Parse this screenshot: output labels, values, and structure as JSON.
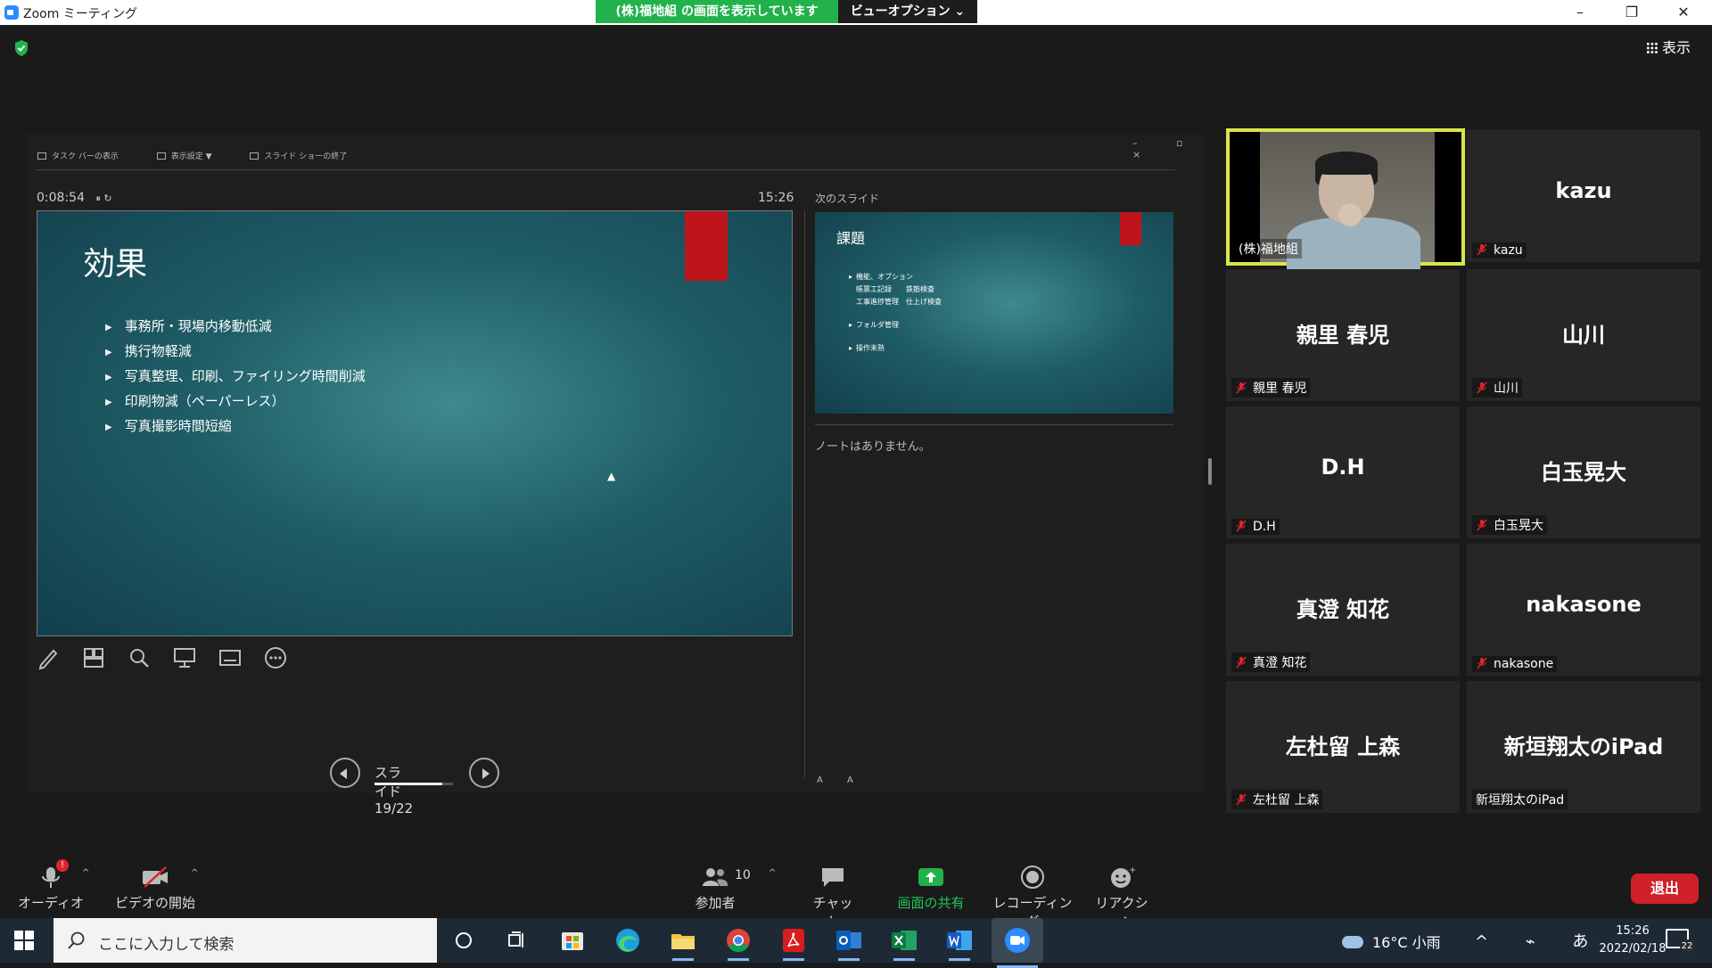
{
  "window": {
    "title": "Zoom ミーティング",
    "share_banner": "(株)福地組 の画面を表示しています",
    "view_options": "ビューオプション ⌄",
    "view_button": "表示"
  },
  "presenter_view": {
    "toolbar": [
      "タスク バーの表示",
      "表示設定 ▼",
      "スライド ショーの終了"
    ],
    "window_controls": "– ▫ ×",
    "timer": "0:08:54",
    "timer_controls": "⏸ ↻",
    "clock": "15:26",
    "next_slide_label": "次のスライド",
    "current_slide": {
      "title": "効果",
      "bullets": [
        "事務所・現場内移動低減",
        "携行物軽減",
        "写真整理、印刷、ファイリング時間削減",
        "印刷物減（ペーパーレス）",
        "写真撮影時間短縮"
      ]
    },
    "next_slide": {
      "title": "課題",
      "lines": [
        {
          "type": "b",
          "text": "機能、オプション"
        },
        {
          "type": "sub",
          "text": "帳票工記録　　鉄筋検査"
        },
        {
          "type": "sub",
          "text": "工事進捗管理　仕上げ検査"
        },
        {
          "type": "gap",
          "text": ""
        },
        {
          "type": "b",
          "text": "フォルダ管理"
        },
        {
          "type": "gap",
          "text": ""
        },
        {
          "type": "b",
          "text": "操作未熟"
        }
      ]
    },
    "notes": "ノートはありません。",
    "font_adjust": "A A",
    "slide_counter": "スライド 19/22",
    "slide_progress": 0.86
  },
  "gallery": [
    {
      "id": "self",
      "display": "",
      "label": "(株)福地組",
      "muted": false,
      "video": true
    },
    {
      "id": "kazu",
      "display": "kazu",
      "label": "kazu",
      "muted": true
    },
    {
      "id": "oyazato",
      "display": "親里 春児",
      "label": "親里 春児",
      "muted": true
    },
    {
      "id": "yamakawa",
      "display": "山川",
      "label": "山川",
      "muted": true
    },
    {
      "id": "dh",
      "display": "D.H",
      "label": "D.H",
      "muted": true
    },
    {
      "id": "shiratama",
      "display": "白玉晃大",
      "label": "白玉晃大",
      "muted": true
    },
    {
      "id": "masumi",
      "display": "真澄 知花",
      "label": "真澄 知花",
      "muted": true
    },
    {
      "id": "nakasone",
      "display": "nakasone",
      "label": "nakasone",
      "muted": true
    },
    {
      "id": "satodome",
      "display": "左杜留 上森",
      "label": "左杜留 上森",
      "muted": true
    },
    {
      "id": "ipad",
      "display": "新垣翔太のiPad",
      "label": "新垣翔太のiPad",
      "muted": false
    }
  ],
  "toolbar": {
    "audio": "オーディオ",
    "video": "ビデオの開始",
    "participants": "参加者",
    "participants_count": "10",
    "chat": "チャット",
    "share": "画面の共有",
    "record": "レコーディング",
    "reaction": "リアクション",
    "end": "退出",
    "audio_badge": "!"
  },
  "taskbar": {
    "search_placeholder": "ここに入力して検索",
    "weather": "16°C 小雨",
    "tray": "^ ⌁ あ",
    "time": "15:26",
    "date": "2022/02/18",
    "notifications": "22"
  },
  "colors": {
    "share_green": "#22b24c",
    "active_speaker": "#d9e64b",
    "slide_accent_red": "#c0141c",
    "end_red": "#d0202a"
  }
}
